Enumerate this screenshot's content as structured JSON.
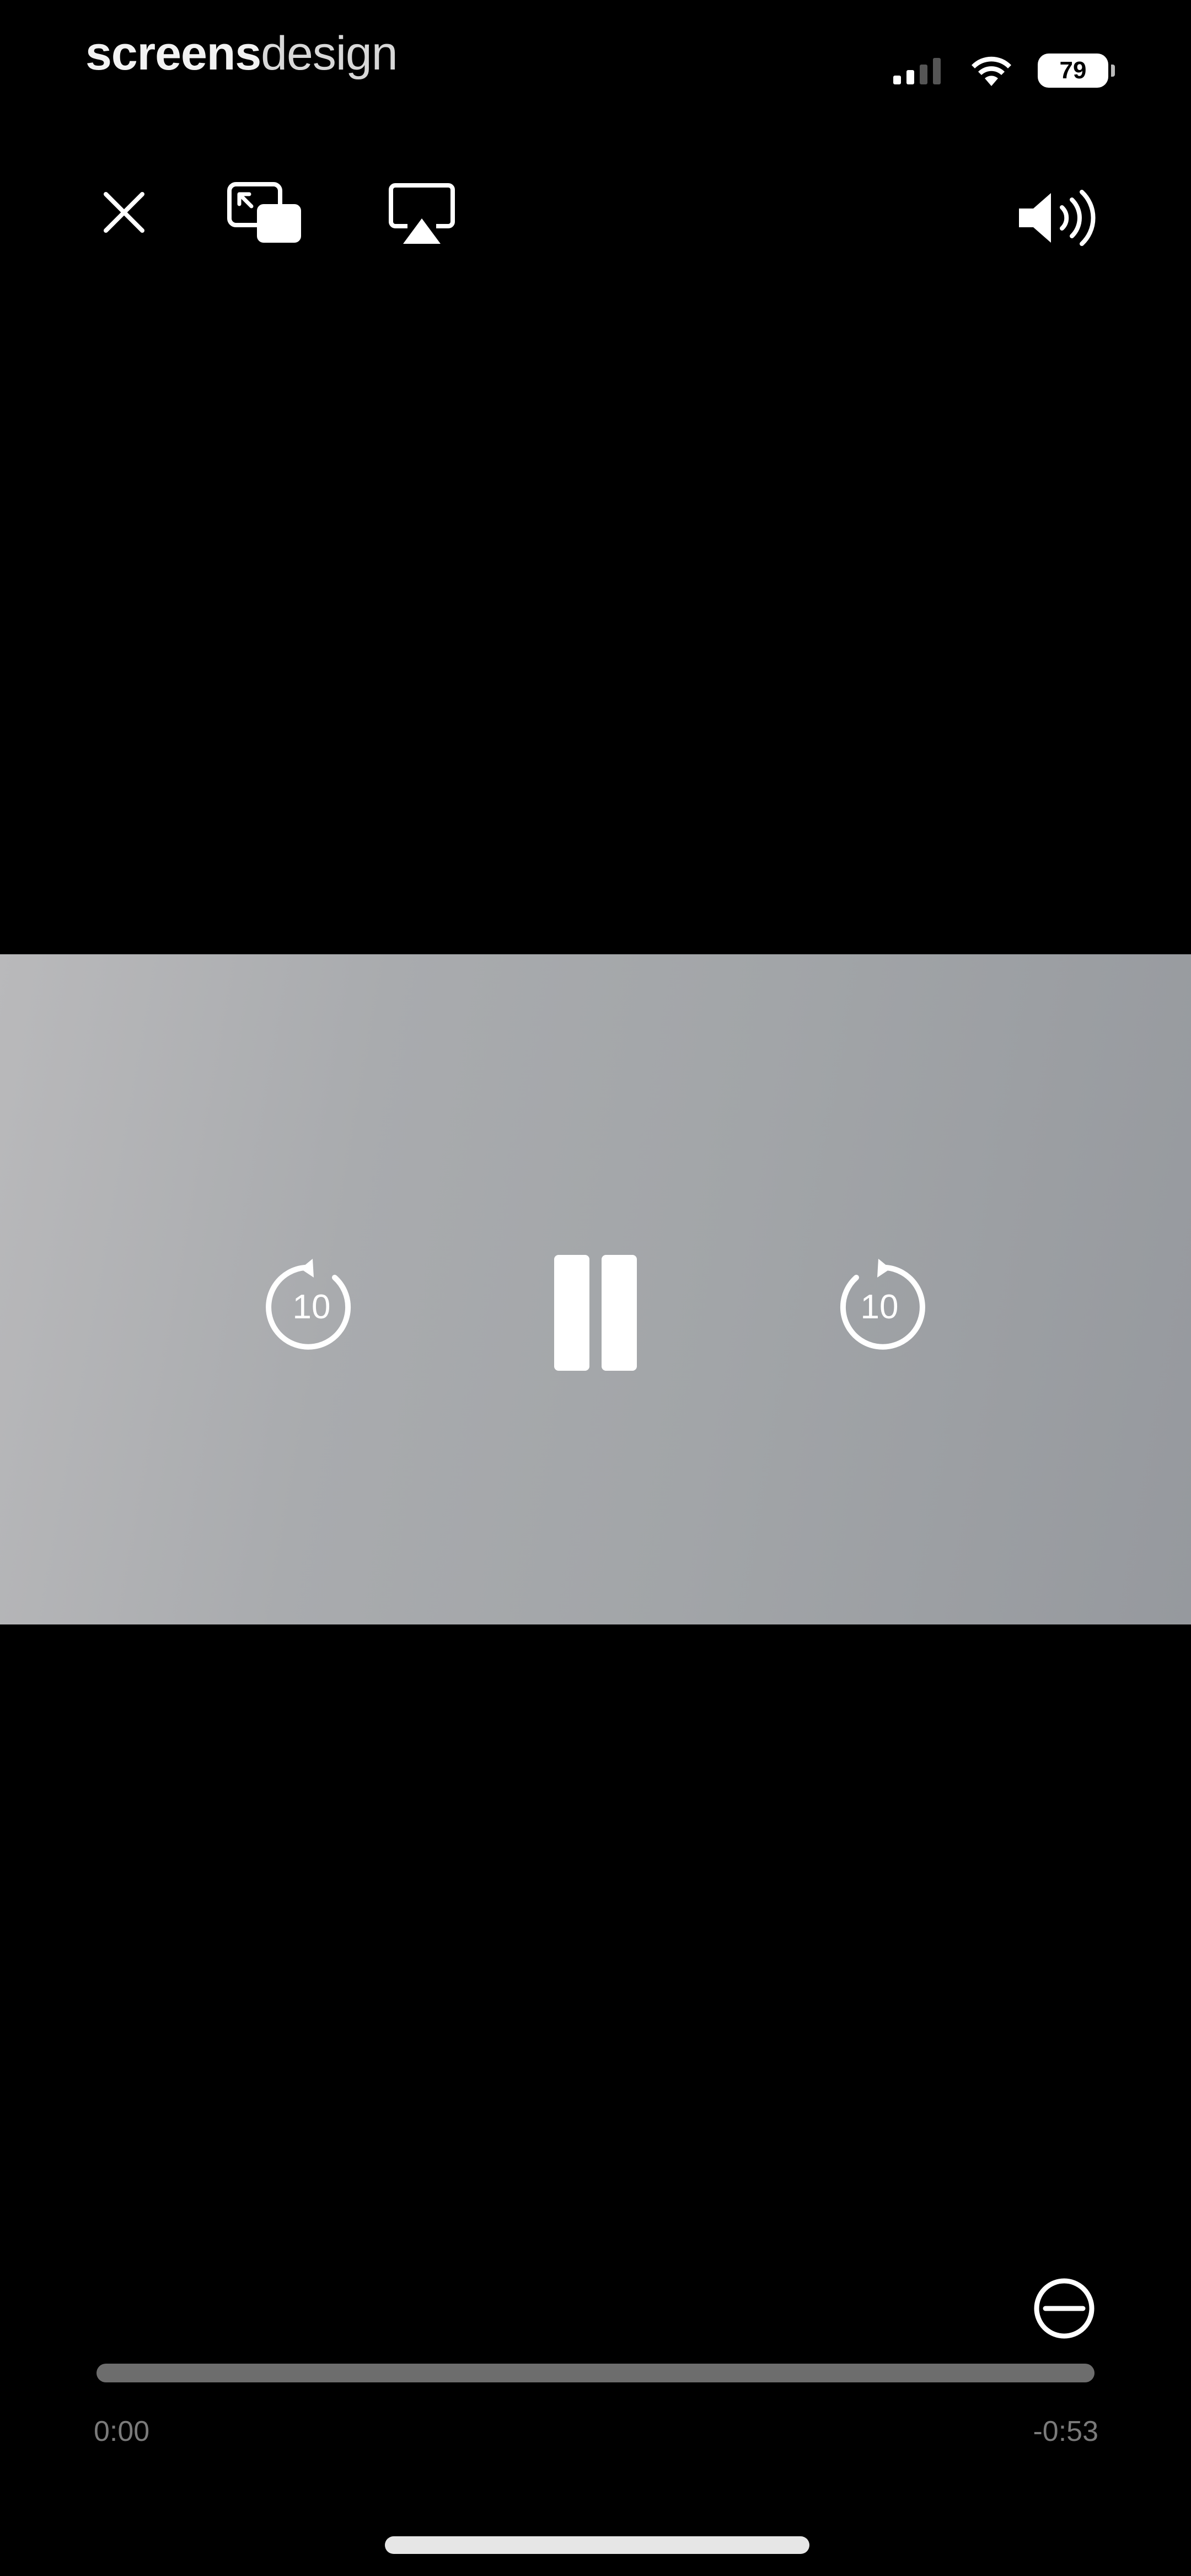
{
  "status_bar": {
    "brand_part1": "screens",
    "brand_part2": "design",
    "battery": "79"
  },
  "icons": {
    "close": "close-icon",
    "pip": "picture-in-picture-icon",
    "airplay": "airplay-icon",
    "volume": "volume-icon",
    "rewind": "rewind-10-icon",
    "pause": "pause-icon",
    "forward": "forward-10-icon",
    "zoom": "zoom-out-icon"
  },
  "player": {
    "skip_label": "10",
    "progress": 0.0,
    "time_elapsed": "0:00",
    "time_remaining": "-0:53"
  },
  "colors": {
    "background": "#000000",
    "video_frame": "#a5a7aa",
    "scrubber_track": "#6d6d6d"
  }
}
